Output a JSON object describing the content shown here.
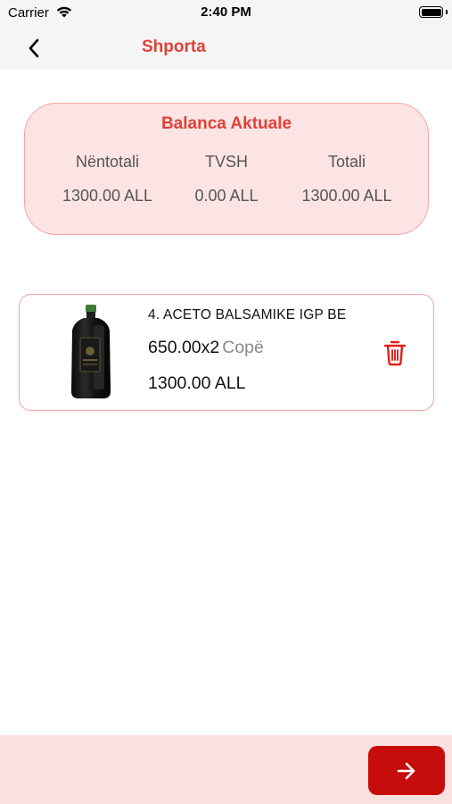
{
  "status_bar": {
    "carrier": "Carrier",
    "time": "2:40 PM",
    "icons": [
      "wifi-icon",
      "battery-icon"
    ]
  },
  "header": {
    "title": "Shporta",
    "back_icon": "chevron-left-icon"
  },
  "balance": {
    "title": "Balanca Aktuale",
    "columns": [
      {
        "label": "Nëntotali",
        "value": "1300.00 ALL"
      },
      {
        "label": "TVSH",
        "value": "0.00 ALL"
      },
      {
        "label": "Totali",
        "value": "1300.00 ALL"
      }
    ]
  },
  "cart": {
    "items": [
      {
        "name": "4. ACETO BALSAMIKE IGP BE",
        "price_quantity": "650.00x2",
        "unit": "Copë",
        "total": "1300.00 ALL",
        "image_icon": "balsamic-bottle-image",
        "action_icon": "trash-icon"
      }
    ]
  },
  "footer": {
    "next_icon": "arrow-right-icon"
  },
  "colors": {
    "accent": "#e04236",
    "card_background": "#fde4e4",
    "card_border": "#f3a5a5",
    "button": "#c70c0c",
    "footer_background": "#fde1e1"
  }
}
